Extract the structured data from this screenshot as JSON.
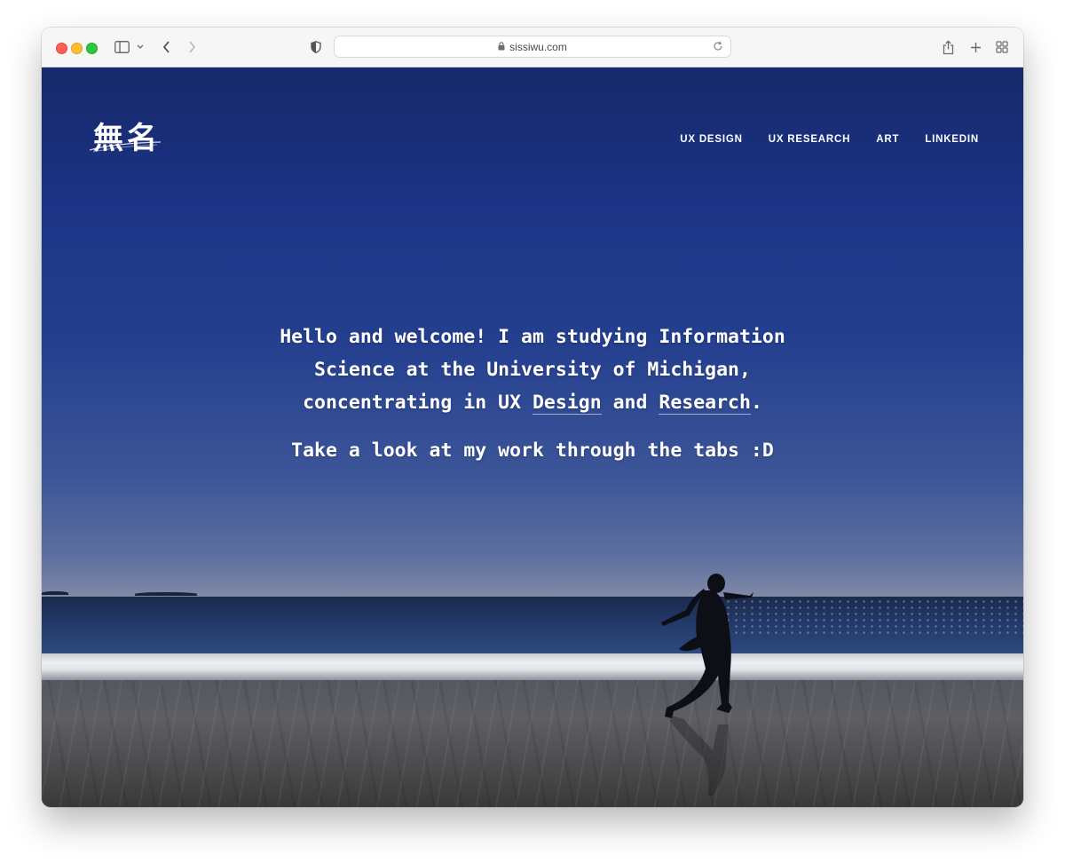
{
  "browser": {
    "url": "sissiwu.com"
  },
  "site": {
    "logo": "無名",
    "nav": [
      "UX DESIGN",
      "UX RESEARCH",
      "ART",
      "LINKEDIN"
    ]
  },
  "hero": {
    "intro_1": "Hello and welcome! I am studying Information Science at the University of Michigan, concentrating in UX ",
    "design_link": "Design",
    "intro_2": " and ",
    "research_link": "Research",
    "intro_3": ".",
    "cta": "Take a look at my work through the tabs :D"
  },
  "colors": {
    "sky_top": "#16296b",
    "sky_horizon": "#8e93aa",
    "text": "#ffffff"
  },
  "icons": {
    "toolbar": [
      "sidebar-icon",
      "chevron-down-icon",
      "back-arrow-icon",
      "forward-arrow-icon",
      "shield-icon",
      "lock-icon",
      "reload-icon",
      "share-icon",
      "plus-icon",
      "tabs-grid-icon"
    ]
  }
}
